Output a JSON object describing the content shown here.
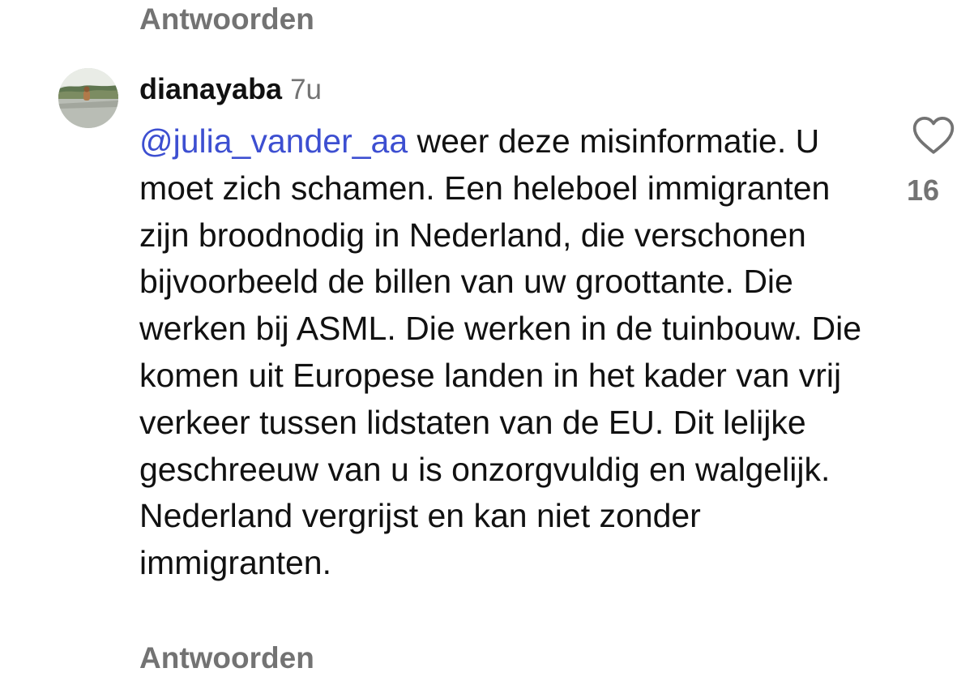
{
  "previous_comment": {
    "reply_label": "Antwoorden"
  },
  "comment": {
    "username": "dianayaba",
    "time": "7u",
    "mention": "@julia_vander_aa",
    "text": " weer deze misinformatie. U moet zich schamen. Een heleboel immigranten zijn broodnodig in Nederland, die verschonen bijvoorbeeld de billen van uw groottante. Die werken bij ASML. Die werken in de tuinbouw. Die komen uit Europese landen in het kader van vrij verkeer tussen lidstaten van de EU. Dit lelijke geschreeuw van u is onzorgvuldig en walgelijk. Nederland vergrijst en kan niet zonder immigranten.",
    "like_icon": "heart-outline-icon",
    "like_count": "16",
    "reply_label": "Antwoorden"
  },
  "colors": {
    "mention": "#3d4fd1",
    "secondary_text": "#737373",
    "primary_text": "#111111",
    "background": "#ffffff"
  }
}
